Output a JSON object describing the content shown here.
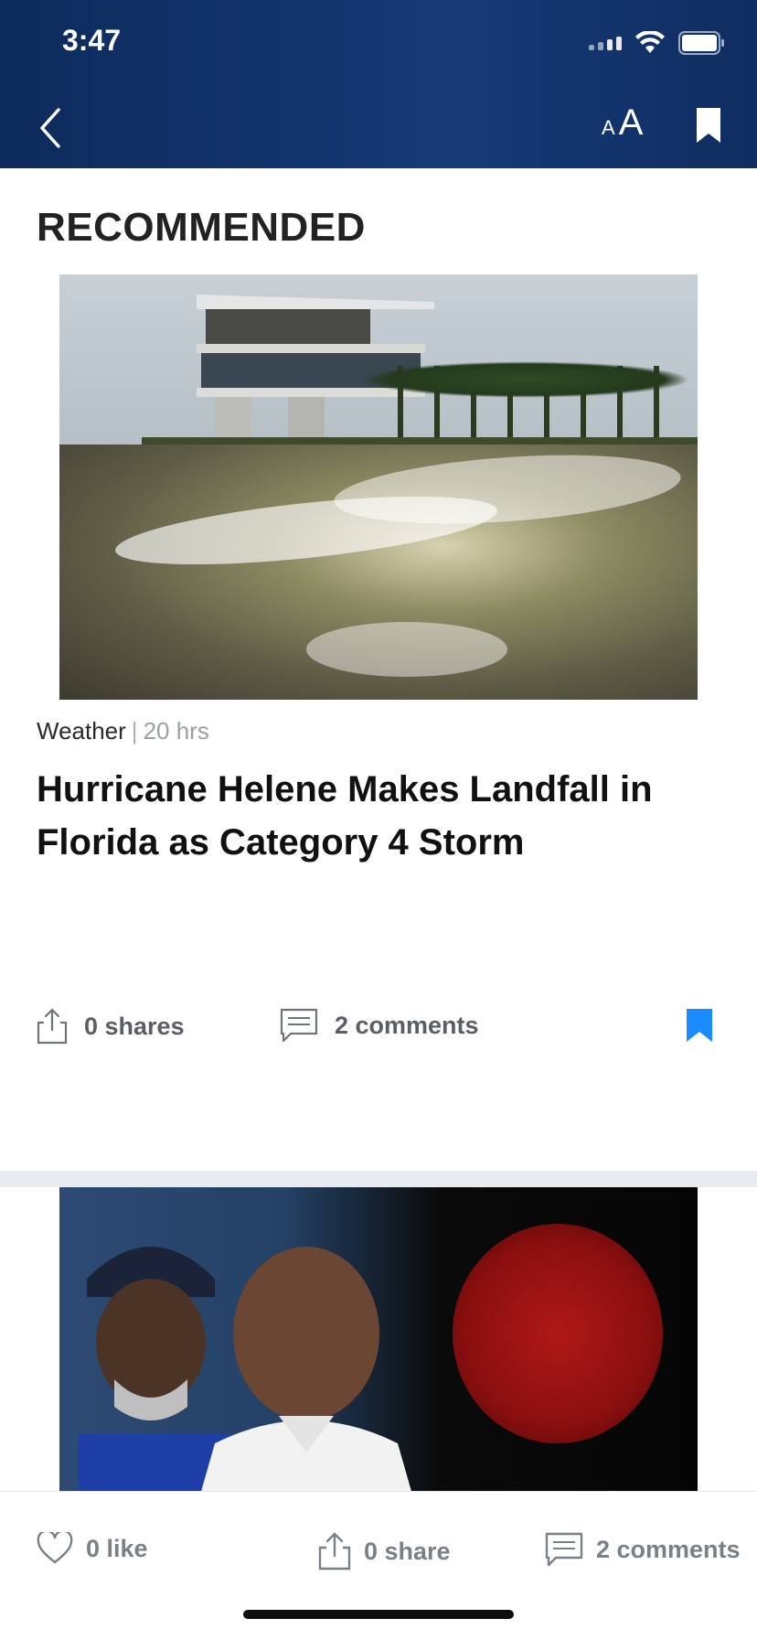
{
  "status_bar": {
    "time": "3:47"
  },
  "header": {
    "text_size_small": "A",
    "text_size_big": "A"
  },
  "section": {
    "title": "RECOMMENDED"
  },
  "article": {
    "category": "Weather",
    "separator": "|",
    "time_ago": "20 hrs",
    "headline": "Hurricane Helene Makes Landfall in Florida as Category 4 Storm",
    "shares_label": "0 shares",
    "comments_label": "2 comments",
    "bookmark_color": "#1a8cff"
  },
  "bottom_bar": {
    "like_label": "0 like",
    "share_label": "0 share",
    "comments_label": "2 comments"
  },
  "colors": {
    "header_bg": "#0d2a5b",
    "accent_blue": "#1a8cff",
    "divider": "#e8ecef"
  }
}
